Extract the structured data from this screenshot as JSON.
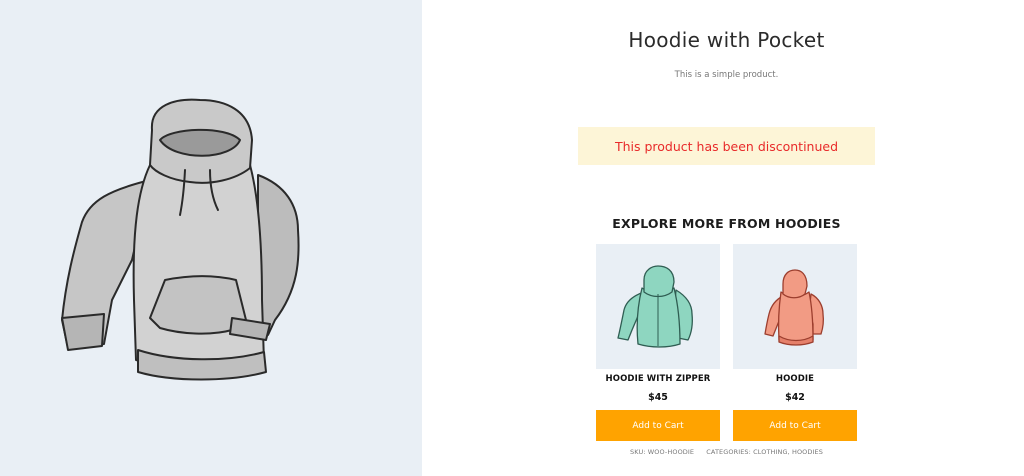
{
  "product": {
    "title": "Hoodie with Pocket",
    "short_description": "This is a simple product.",
    "notice": "This product has been discontinued",
    "image_icon": "gray-hoodie-illustration",
    "sku": "SKU: WOO-HOODIE",
    "categories": "CATEGORIES: CLOTHING, HOODIES"
  },
  "explore": {
    "heading": "EXPLORE MORE FROM HOODIES",
    "items": [
      {
        "name": "HOODIE WITH ZIPPER",
        "price": "$45",
        "button": "Add to Cart",
        "image_icon": "green-zip-hoodie-illustration"
      },
      {
        "name": "HOODIE",
        "price": "$42",
        "button": "Add to Cart",
        "image_icon": "coral-hoodie-illustration"
      }
    ]
  },
  "colors": {
    "accent_button": "#ffa300",
    "notice_text": "#e82a2a",
    "notice_background": "#fdf5d7",
    "image_background": "#e9eff5"
  }
}
